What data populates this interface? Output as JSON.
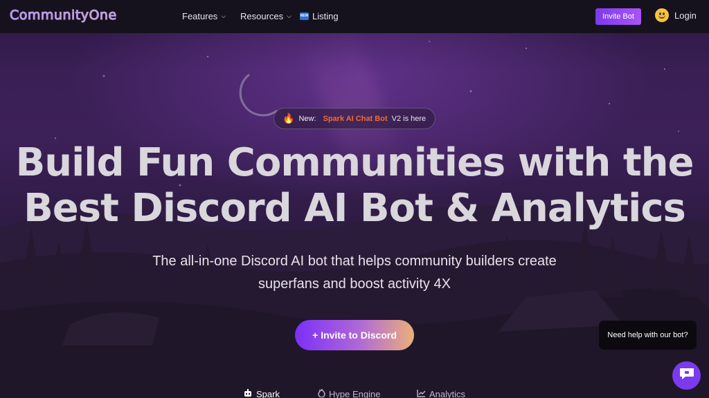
{
  "nav": {
    "logo": "CommunityOne",
    "features_label": "Features",
    "resources_label": "Resources",
    "listing_badge": "NEW",
    "listing_label": "Listing",
    "invite_bot_label": "Invite Bot",
    "login_label": "Login"
  },
  "hero": {
    "announce_new": "New:",
    "announce_link": "Spark AI Chat Bot",
    "announce_rest": "V2 is here",
    "headline_line1": "Build Fun Communities with the",
    "headline_line2": "Best Discord AI Bot & Analytics",
    "subhead_line1": "The all-in-one Discord AI bot that helps community builders create",
    "subhead_line2": "superfans and boost activity 4X",
    "cta_label": "+ Invite to Discord"
  },
  "tabs": [
    {
      "label": "Spark",
      "icon": "robot-icon"
    },
    {
      "label": "Hype Engine",
      "icon": "flame-icon"
    },
    {
      "label": "Analytics",
      "icon": "chart-line-icon"
    }
  ],
  "chat": {
    "bubble_text": "Need help with our bot?",
    "button_icon": "chat-icon"
  },
  "colors": {
    "accent": "#7c3aed",
    "link": "#f06a3c",
    "nav_bg": "#16121d"
  }
}
